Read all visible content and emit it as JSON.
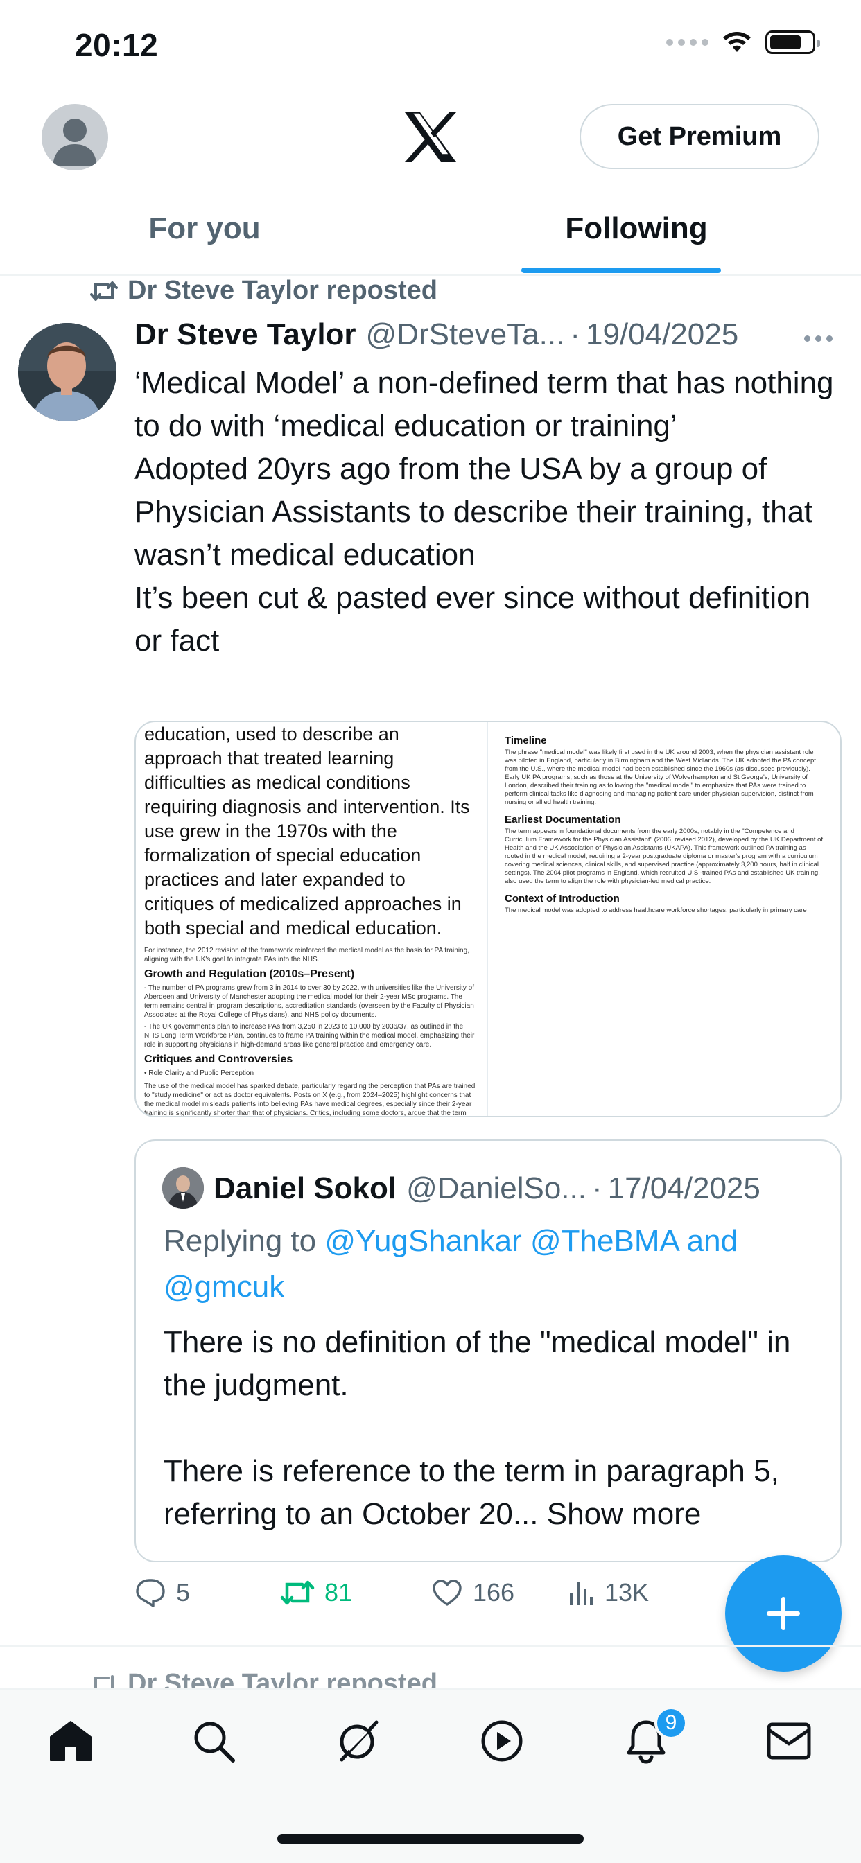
{
  "status_bar": {
    "time": "20:12"
  },
  "header": {
    "premium_label": "Get Premium"
  },
  "tabs": [
    {
      "label": "For you",
      "active": false
    },
    {
      "label": "Following",
      "active": true
    }
  ],
  "post": {
    "repost_label": "Dr Steve Taylor reposted",
    "author_name": "Dr Steve Taylor",
    "author_handle": "@DrSteveTa...",
    "separator": "·",
    "date": "19/04/2025",
    "text_lines": [
      "‘Medical Model’ a non-defined term that has nothing to do with ‘medical education or training’",
      "Adopted 20yrs ago from the USA by a group of Physician Assistants to describe their training, that wasn’t medical education",
      "It’s been cut & pasted ever since without definition or fact"
    ],
    "media": {
      "left_big_text": "education, used to describe an approach that treated learning difficulties as medical conditions requiring diagnosis and intervention. Its use grew in the 1970s with the formalization of special education practices and later expanded to critiques of medicalized approaches in both special and medical education.",
      "left_pre": "For instance, the 2012 revision of the framework reinforced the medical model as the basis for PA training, aligning with the UK's goal to integrate PAs into the NHS.",
      "left_h1": "Growth and Regulation (2010s–Present)",
      "left_p1": "- The number of PA programs grew from 3 in 2014 to over 30 by 2022, with universities like the University of Aberdeen and University of Manchester adopting the medical model for their 2-year MSc programs. The term remains central in program descriptions, accreditation standards (overseen by the Faculty of Physician Associates at the Royal College of Physicians), and NHS policy documents.",
      "left_p2": "- The UK government's plan to increase PAs from 3,250 in 2023 to 10,000 by 2036/37, as outlined in the NHS Long Term Workforce Plan, continues to frame PA training within the medical model, emphasizing their role in supporting physicians in high-demand areas like general practice and emergency care.",
      "left_h2": "Critiques and Controversies",
      "left_p3": "• Role Clarity and Public Perception",
      "left_p4": "The use of the medical model has sparked debate, particularly regarding the perception that PAs are trained to \"study medicine\" or act as doctor equivalents. Posts on X (e.g., from 2024–2025) highlight concerns that the medical model misleads patients into believing PAs have medical degrees, especially since their 2-year training is significantly shorter than that of physicians. Critics, including some doctors, argue that the term fuels confusion and risks patient safety when",
      "right_h1": "Timeline",
      "right_p1": "The phrase \"medical model\" was likely first used in the UK around 2003, when the physician assistant role was piloted in England, particularly in Birmingham and the West Midlands. The UK adopted the PA concept from the U.S., where the medical model had been established since the 1960s (as discussed previously). Early UK PA programs, such as those at the University of Wolverhampton and St George's, University of London, described their training as following the \"medical model\" to emphasize that PAs were trained to perform clinical tasks like diagnosing and managing patient care under physician supervision, distinct from nursing or allied health training.",
      "right_h2": "Earliest Documentation",
      "right_p2": "The term appears in foundational documents from the early 2000s, notably in the \"Competence and Curriculum Framework for the Physician Assistant\" (2006, revised 2012), developed by the UK Department of Health and the UK Association of Physician Assistants (UKAPA). This framework outlined PA training as rooted in the medical model, requiring a 2-year postgraduate diploma or master's program with a curriculum covering medical sciences, clinical skills, and supervised practice (approximately 3,200 hours, half in clinical settings). The 2004 pilot programs in England, which recruited U.S.-trained PAs and established UK training, also used the term to align the role with physician-led medical practice.",
      "right_h3": "Context of Introduction",
      "right_p3": "The medical model was adopted to address healthcare workforce shortages, particularly in primary care"
    },
    "quote": {
      "author_name": "Daniel Sokol",
      "author_handle": "@DanielSo...",
      "separator": "·",
      "date": "17/04/2025",
      "replying_prefix": "Replying to",
      "mentions": "@YugShankar @TheBMA and @gmcuk",
      "paragraph1": "There is no definition of the \"medical model\" in the judgment.",
      "paragraph2": "There is reference to the term in paragraph 5, referring to an October 20...",
      "show_more": "Show more"
    },
    "actions": {
      "replies": "5",
      "reposts": "81",
      "likes": "166",
      "views": "13K"
    }
  },
  "next_post": {
    "repost_label": "Dr Steve Taylor reposted"
  },
  "nav": {
    "items": [
      "home-icon",
      "search-icon",
      "grok-icon",
      "video-icon",
      "bell-icon",
      "mail-icon"
    ],
    "notification_count": "9"
  },
  "colors": {
    "accent": "#1d9bf0",
    "repost_green": "#00ba7c",
    "secondary_text": "#536471",
    "primary_text": "#0f1419"
  }
}
